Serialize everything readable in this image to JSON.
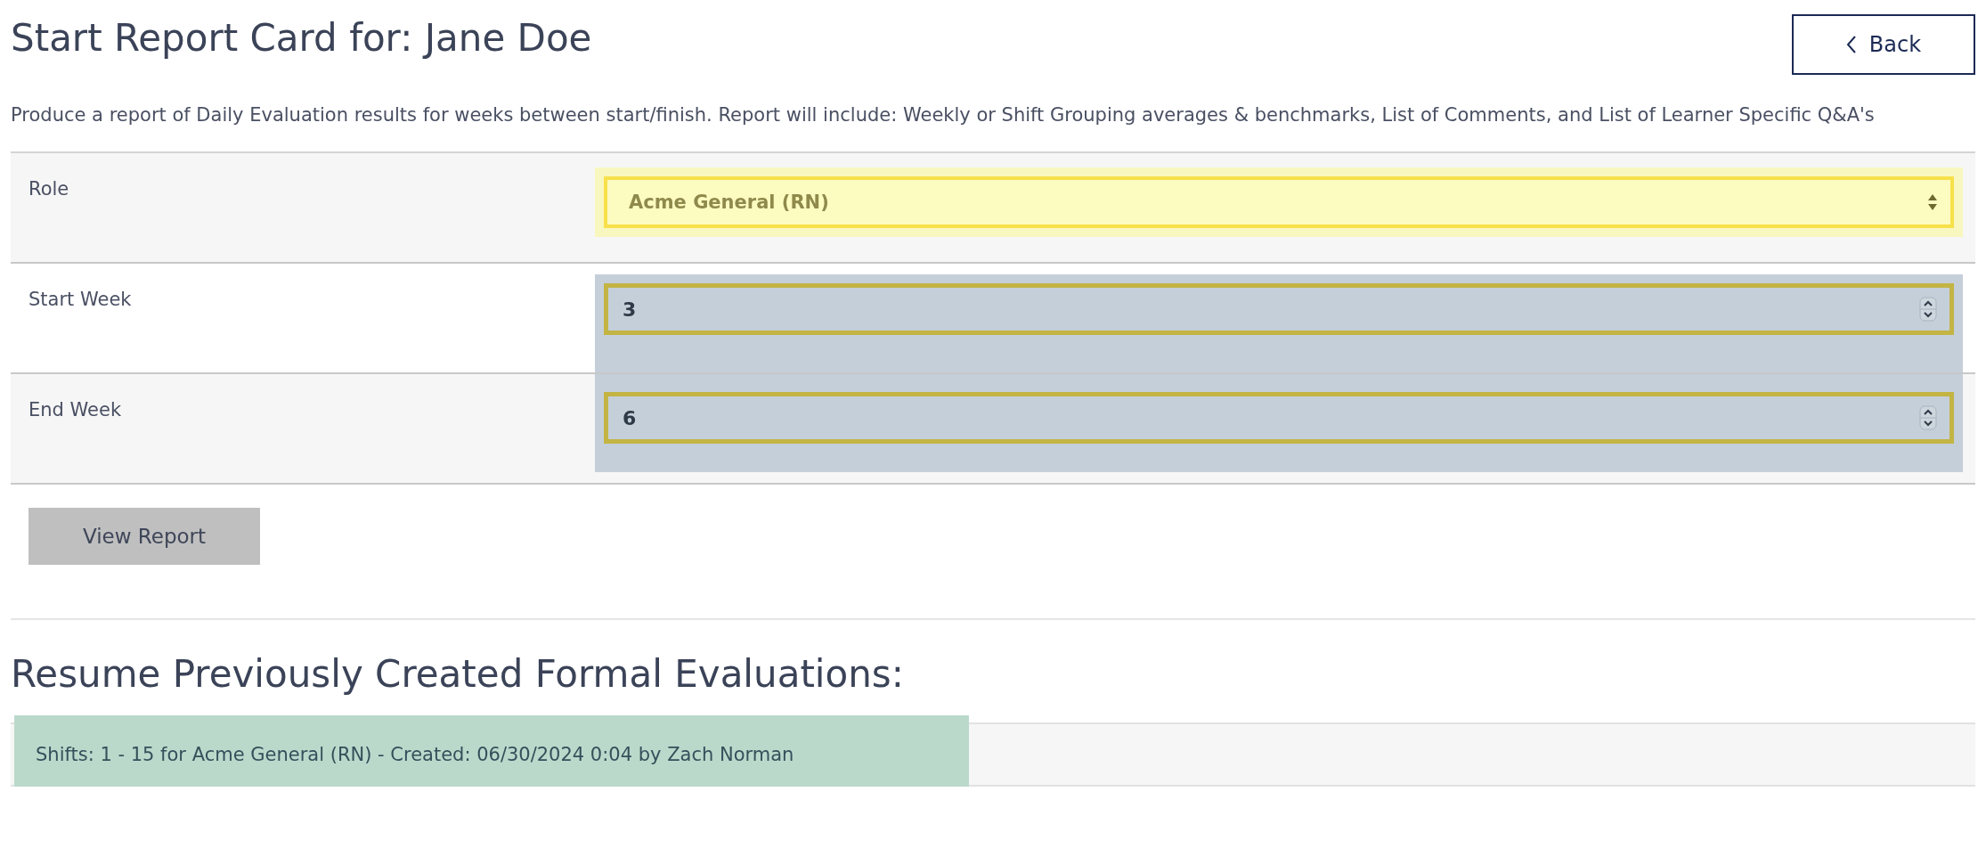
{
  "title": "Start Report Card for: Jane Doe",
  "back_button": {
    "label": "Back"
  },
  "description": "Produce a report of Daily Evaluation results for weeks between start/finish. Report will include: Weekly or Shift Grouping averages & benchmarks, List of Comments, and List of Learner Specific Q&A's",
  "form_rows": [
    {
      "label": "Role",
      "kind": "select",
      "value": "Acme General (RN)"
    },
    {
      "label": "Start Week",
      "kind": "number",
      "value": "3"
    },
    {
      "label": "End Week",
      "kind": "number",
      "value": "6"
    }
  ],
  "view_button": {
    "label": "View Report"
  },
  "section_title": "Resume Previously Created Formal Evaluations:",
  "evaluations": [
    {
      "text": "Shifts: 1 - 15 for Acme General (RN) - Created: 06/30/2024 0:04 by Zach Norman"
    }
  ]
}
